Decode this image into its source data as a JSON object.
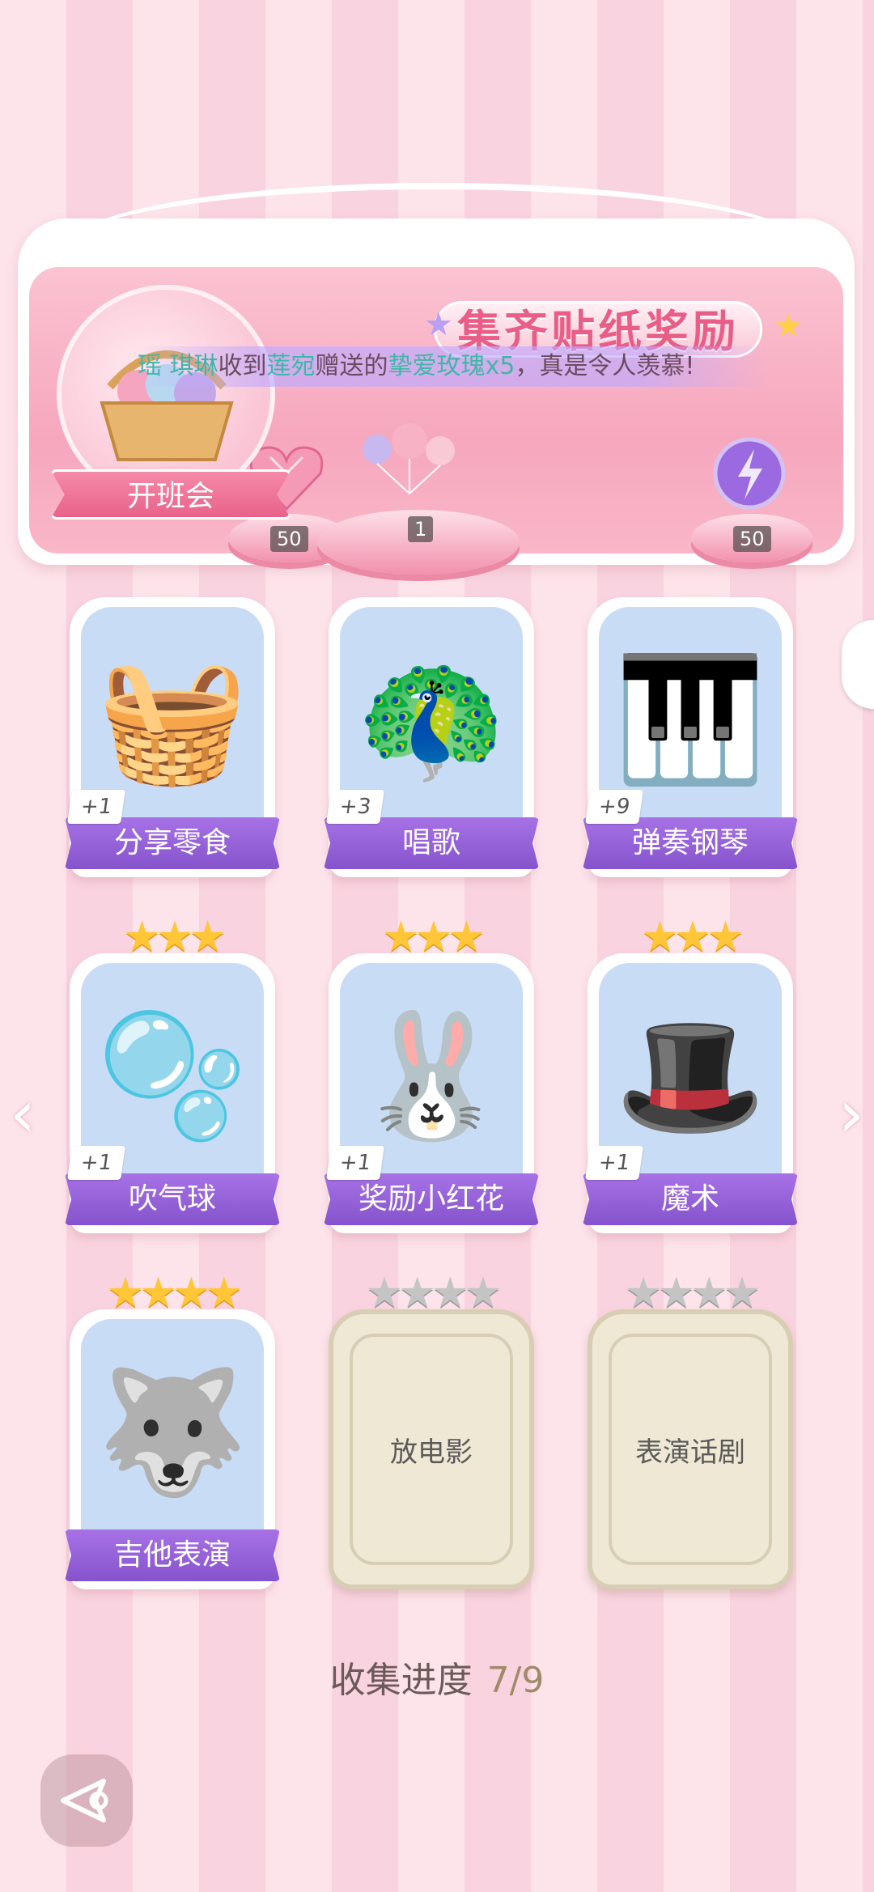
{
  "panel": {
    "title": "集齐贴纸奖励",
    "class_button": "开班会",
    "marquee": {
      "sender": "瑶 琪琳",
      "part1": "收到",
      "giver": "莲宛",
      "part2": "赠送的",
      "gift": "挚爱玫瑰x5",
      "part3": "，真是令人羡慕!"
    },
    "rewards": [
      {
        "icon": "heart-gem-icon",
        "count": "50"
      },
      {
        "icon": "balloons-icon",
        "count": "1"
      },
      {
        "icon": "energy-orb-icon",
        "count": "50"
      }
    ]
  },
  "cards": [
    {
      "label": "分享零食",
      "plus": "+1",
      "stars": "",
      "icon": "snack-basket-icon",
      "emoji": "🧺"
    },
    {
      "label": "唱歌",
      "plus": "+3",
      "stars": "",
      "icon": "peacock-icon",
      "emoji": "🦚"
    },
    {
      "label": "弹奏钢琴",
      "plus": "+9",
      "stars": "",
      "icon": "piano-boy-icon",
      "emoji": "🎹"
    },
    {
      "label": "吹气球",
      "plus": "+1",
      "stars": "★★★",
      "icon": "bubble-boy-icon",
      "emoji": "🫧"
    },
    {
      "label": "奖励小红花",
      "plus": "+1",
      "stars": "★★★",
      "icon": "bunny-flower-icon",
      "emoji": "🐰"
    },
    {
      "label": "魔术",
      "plus": "+1",
      "stars": "★★★",
      "icon": "magician-icon",
      "emoji": "🎩"
    },
    {
      "label": "吉他表演",
      "plus": "",
      "stars": "★★★★",
      "icon": "wolf-guitar-icon",
      "emoji": "🐺"
    },
    {
      "label": "放电影",
      "stars": "★★★★",
      "locked": true
    },
    {
      "label": "表演话剧",
      "stars": "★★★★",
      "locked": true
    }
  ],
  "progress": {
    "label": "收集进度",
    "value": "7/9"
  },
  "colors": {
    "accent": "#ea5d87",
    "label_purple": "#9a64dc",
    "star_gold": "#ffc637"
  }
}
